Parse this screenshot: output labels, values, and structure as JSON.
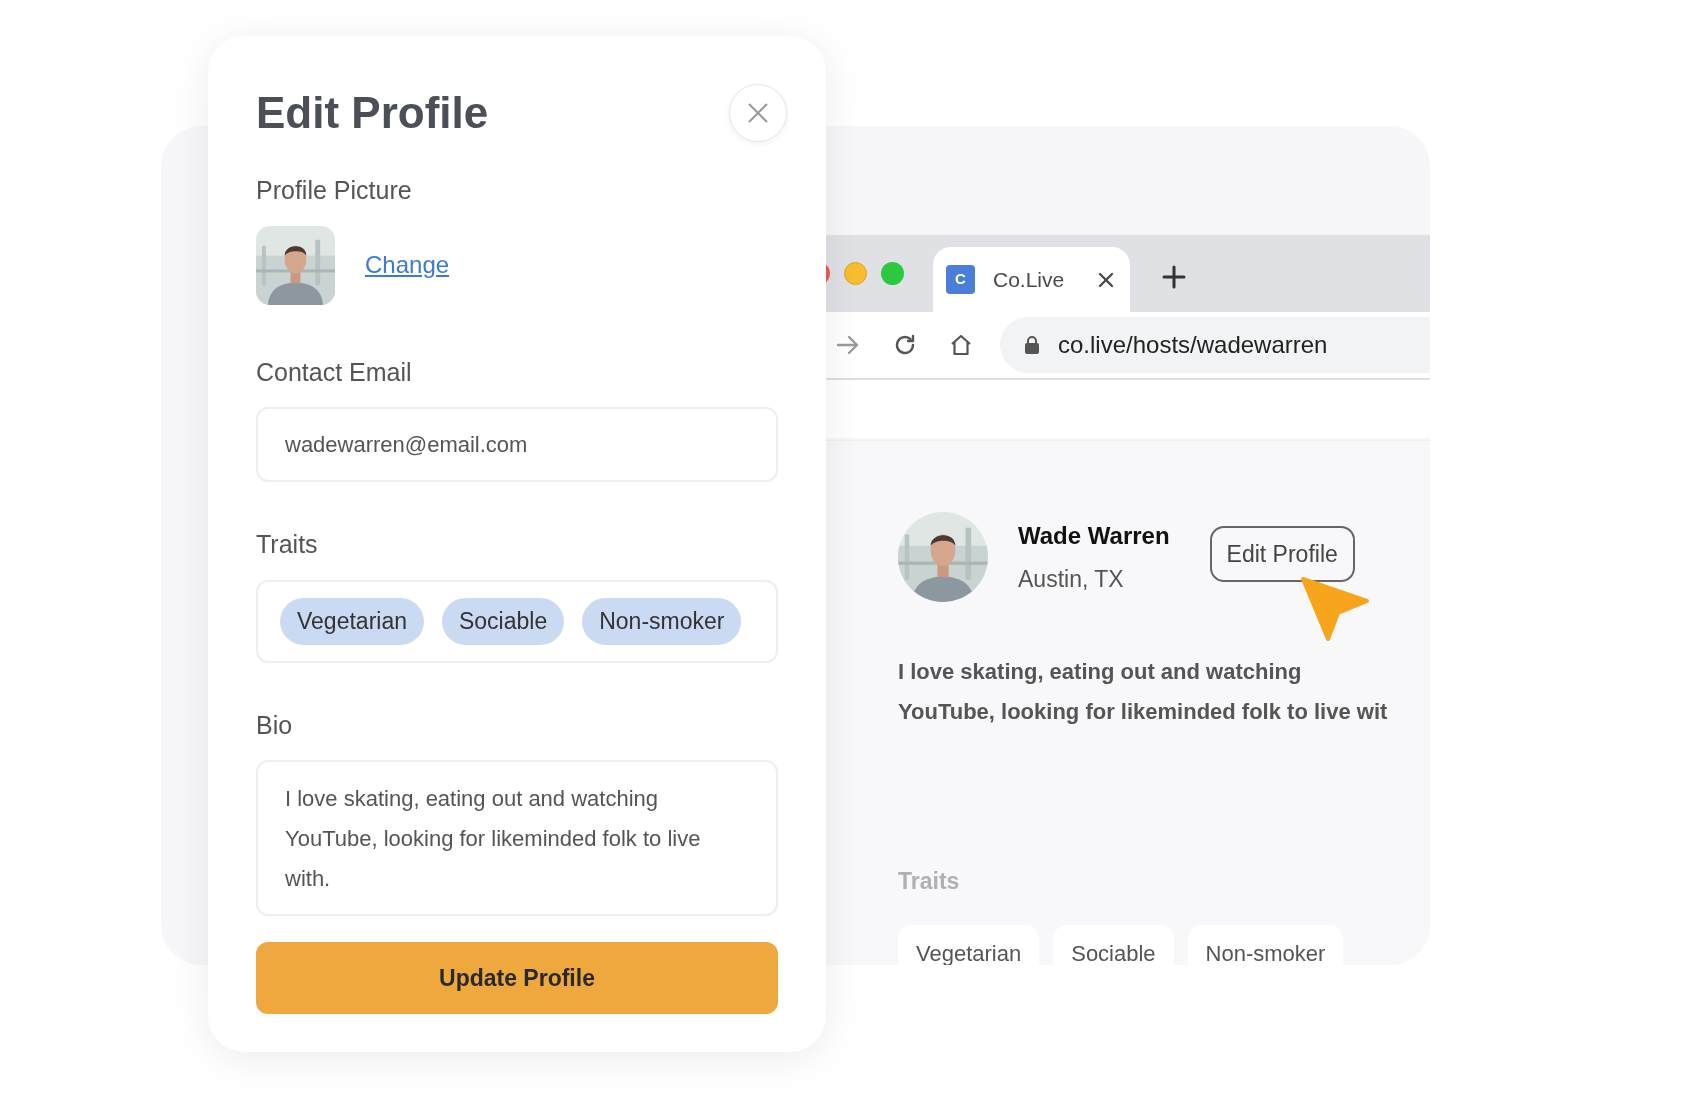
{
  "browser": {
    "tab": {
      "favicon": "C",
      "title": "Co.Live"
    },
    "url": "co.live/hosts/wadewarren",
    "profile": {
      "name": "Wade Warren",
      "location": "Austin, TX",
      "edit_button": "Edit Profile",
      "bio_lines": [
        "I love skating, eating out and watching",
        "YouTube, looking for likeminded folk to live wit"
      ],
      "traits_label": "Traits",
      "traits": [
        "Vegetarian",
        "Sociable",
        "Non-smoker"
      ]
    }
  },
  "modal": {
    "title": "Edit Profile",
    "picture_label": "Profile Picture",
    "change_link": "Change",
    "email_label": "Contact Email",
    "email_value": "wadewarren@email.com",
    "traits_label": "Traits",
    "traits": [
      "Vegetarian",
      "Sociable",
      "Non-smoker"
    ],
    "bio_label": "Bio",
    "bio_value": "I love skating, eating out and watching YouTube, looking for likeminded folk to live with.",
    "submit": "Update Profile"
  }
}
